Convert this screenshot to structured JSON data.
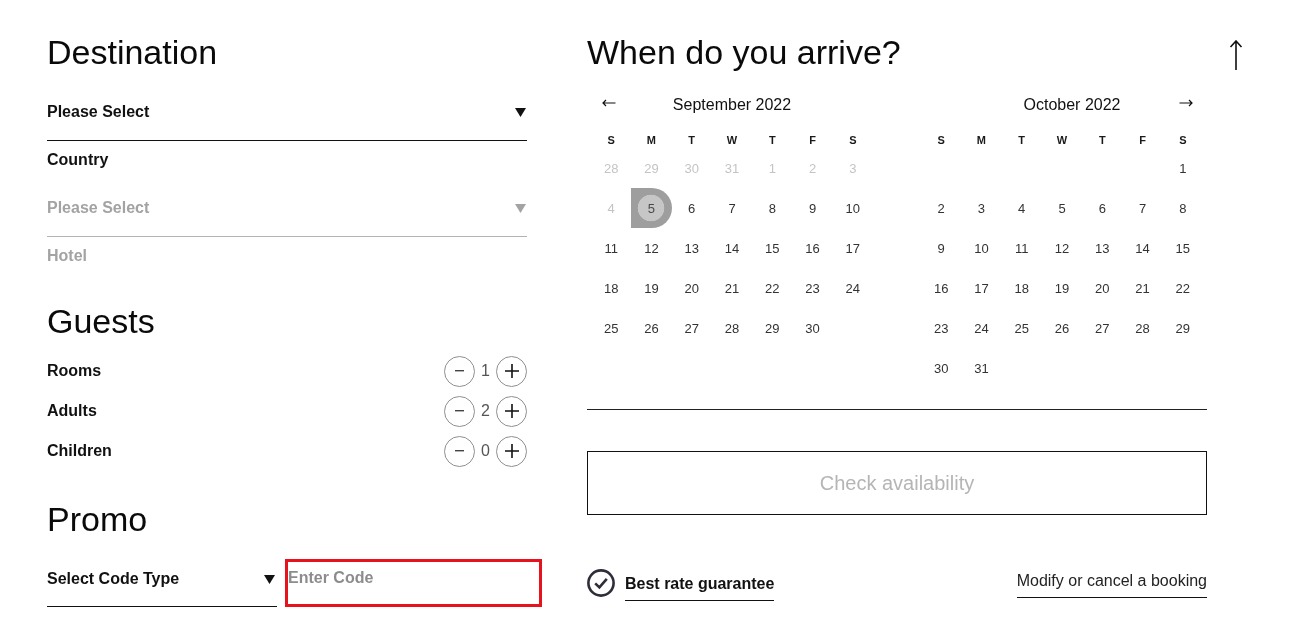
{
  "destination": {
    "title": "Destination",
    "items": [
      {
        "kind": "select",
        "value": "Please Select",
        "disabled": false
      },
      {
        "kind": "label",
        "text": "Country",
        "disabled": false
      },
      {
        "kind": "select",
        "value": "Please Select",
        "disabled": true
      },
      {
        "kind": "label",
        "text": "Hotel",
        "disabled": true
      }
    ]
  },
  "guests": {
    "title": "Guests",
    "counters": [
      {
        "label": "Rooms",
        "value": "1"
      },
      {
        "label": "Adults",
        "value": "2"
      },
      {
        "label": "Children",
        "value": "0"
      }
    ]
  },
  "promo": {
    "title": "Promo",
    "code_type": {
      "value": "Select Code Type"
    },
    "code": {
      "placeholder": "Enter Code",
      "invalid": true
    }
  },
  "arrival": {
    "title": "When do you arrive?",
    "months": [
      {
        "title": "September 2022",
        "weekdays": [
          "S",
          "M",
          "T",
          "W",
          "T",
          "F",
          "S"
        ],
        "weeks": [
          [
            {
              "day": "28",
              "disabled": true,
              "selected": false
            },
            {
              "day": "29",
              "disabled": true,
              "selected": false
            },
            {
              "day": "30",
              "disabled": true,
              "selected": false
            },
            {
              "day": "31",
              "disabled": true,
              "selected": false
            },
            {
              "day": "1",
              "disabled": true,
              "selected": false
            },
            {
              "day": "2",
              "disabled": true,
              "selected": false
            },
            {
              "day": "3",
              "disabled": true,
              "selected": false
            }
          ],
          [
            {
              "day": "4",
              "disabled": true,
              "selected": false
            },
            {
              "day": "5",
              "disabled": false,
              "selected": true
            },
            {
              "day": "6",
              "disabled": false,
              "selected": false
            },
            {
              "day": "7",
              "disabled": false,
              "selected": false
            },
            {
              "day": "8",
              "disabled": false,
              "selected": false
            },
            {
              "day": "9",
              "disabled": false,
              "selected": false
            },
            {
              "day": "10",
              "disabled": false,
              "selected": false
            }
          ],
          [
            {
              "day": "11",
              "disabled": false,
              "selected": false
            },
            {
              "day": "12",
              "disabled": false,
              "selected": false
            },
            {
              "day": "13",
              "disabled": false,
              "selected": false
            },
            {
              "day": "14",
              "disabled": false,
              "selected": false
            },
            {
              "day": "15",
              "disabled": false,
              "selected": false
            },
            {
              "day": "16",
              "disabled": false,
              "selected": false
            },
            {
              "day": "17",
              "disabled": false,
              "selected": false
            }
          ],
          [
            {
              "day": "18",
              "disabled": false,
              "selected": false
            },
            {
              "day": "19",
              "disabled": false,
              "selected": false
            },
            {
              "day": "20",
              "disabled": false,
              "selected": false
            },
            {
              "day": "21",
              "disabled": false,
              "selected": false
            },
            {
              "day": "22",
              "disabled": false,
              "selected": false
            },
            {
              "day": "23",
              "disabled": false,
              "selected": false
            },
            {
              "day": "24",
              "disabled": false,
              "selected": false
            }
          ],
          [
            {
              "day": "25",
              "disabled": false,
              "selected": false
            },
            {
              "day": "26",
              "disabled": false,
              "selected": false
            },
            {
              "day": "27",
              "disabled": false,
              "selected": false
            },
            {
              "day": "28",
              "disabled": false,
              "selected": false
            },
            {
              "day": "29",
              "disabled": false,
              "selected": false
            },
            {
              "day": "30",
              "disabled": false,
              "selected": false
            }
          ]
        ]
      },
      {
        "title": "October 2022",
        "weekdays": [
          "S",
          "M",
          "T",
          "W",
          "T",
          "F",
          "S"
        ],
        "weeks": [
          [
            {
              "day": "1",
              "disabled": false,
              "selected": false
            }
          ],
          [
            {
              "day": "2",
              "disabled": false,
              "selected": false
            },
            {
              "day": "3",
              "disabled": false,
              "selected": false
            },
            {
              "day": "4",
              "disabled": false,
              "selected": false
            },
            {
              "day": "5",
              "disabled": false,
              "selected": false
            },
            {
              "day": "6",
              "disabled": false,
              "selected": false
            },
            {
              "day": "7",
              "disabled": false,
              "selected": false
            },
            {
              "day": "8",
              "disabled": false,
              "selected": false
            }
          ],
          [
            {
              "day": "9",
              "disabled": false,
              "selected": false
            },
            {
              "day": "10",
              "disabled": false,
              "selected": false
            },
            {
              "day": "11",
              "disabled": false,
              "selected": false
            },
            {
              "day": "12",
              "disabled": false,
              "selected": false
            },
            {
              "day": "13",
              "disabled": false,
              "selected": false
            },
            {
              "day": "14",
              "disabled": false,
              "selected": false
            },
            {
              "day": "15",
              "disabled": false,
              "selected": false
            }
          ],
          [
            {
              "day": "16",
              "disabled": false,
              "selected": false
            },
            {
              "day": "17",
              "disabled": false,
              "selected": false
            },
            {
              "day": "18",
              "disabled": false,
              "selected": false
            },
            {
              "day": "19",
              "disabled": false,
              "selected": false
            },
            {
              "day": "20",
              "disabled": false,
              "selected": false
            },
            {
              "day": "21",
              "disabled": false,
              "selected": false
            },
            {
              "day": "22",
              "disabled": false,
              "selected": false
            }
          ],
          [
            {
              "day": "23",
              "disabled": false,
              "selected": false
            },
            {
              "day": "24",
              "disabled": false,
              "selected": false
            },
            {
              "day": "25",
              "disabled": false,
              "selected": false
            },
            {
              "day": "26",
              "disabled": false,
              "selected": false
            },
            {
              "day": "27",
              "disabled": false,
              "selected": false
            },
            {
              "day": "28",
              "disabled": false,
              "selected": false
            },
            {
              "day": "29",
              "disabled": false,
              "selected": false
            }
          ],
          [
            {
              "day": "30",
              "disabled": false,
              "selected": false
            },
            {
              "day": "31",
              "disabled": false,
              "selected": false
            }
          ]
        ]
      }
    ]
  },
  "check_button": {
    "label": "Check availability",
    "disabled": true
  },
  "footer": {
    "guarantee": "Best rate guarantee",
    "manage_link": "Modify or cancel a booking"
  }
}
